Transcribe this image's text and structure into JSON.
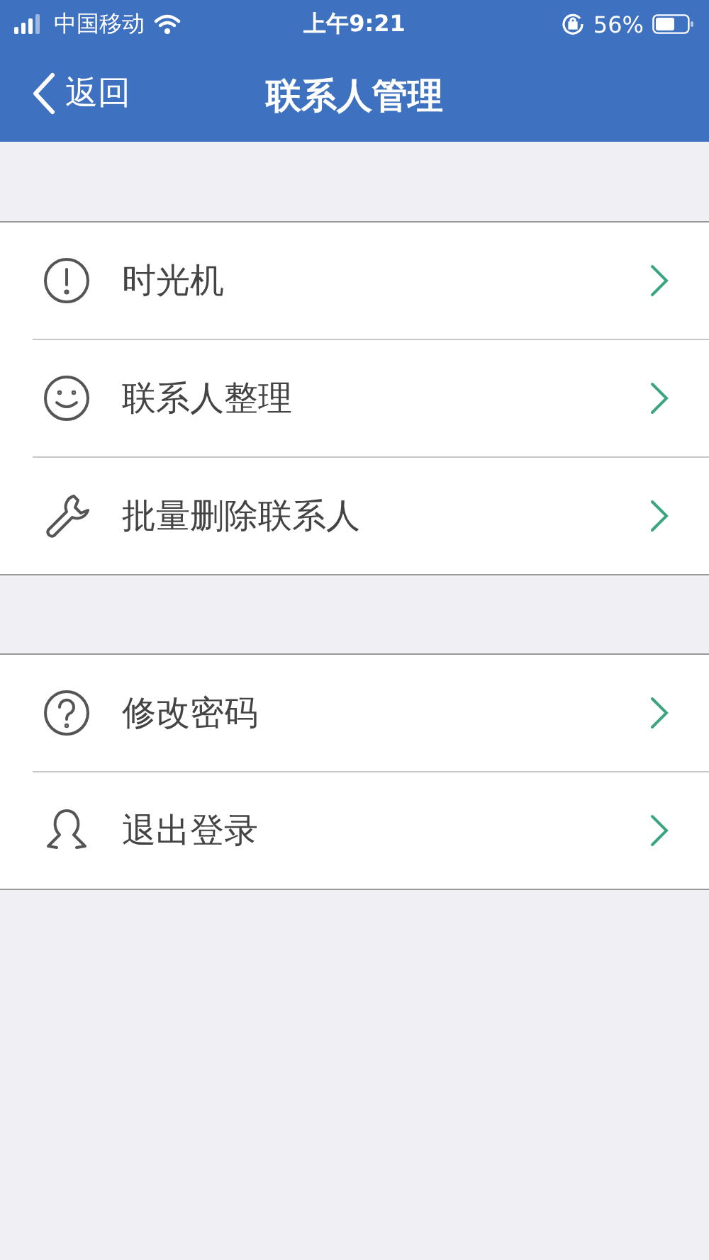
{
  "status_bar": {
    "carrier": "中国移动",
    "time": "上午9:21",
    "battery": "56%"
  },
  "nav_bar": {
    "back": "返回",
    "title": "联系人管理"
  },
  "groups": [
    {
      "items": [
        {
          "kind": "alert",
          "label": "时光机"
        },
        {
          "kind": "smile",
          "label": "联系人整理"
        },
        {
          "kind": "wrench",
          "label": "批量删除联系人"
        }
      ]
    },
    {
      "items": [
        {
          "kind": "question",
          "label": "修改密码"
        },
        {
          "kind": "person",
          "label": "退出登录"
        }
      ]
    }
  ]
}
